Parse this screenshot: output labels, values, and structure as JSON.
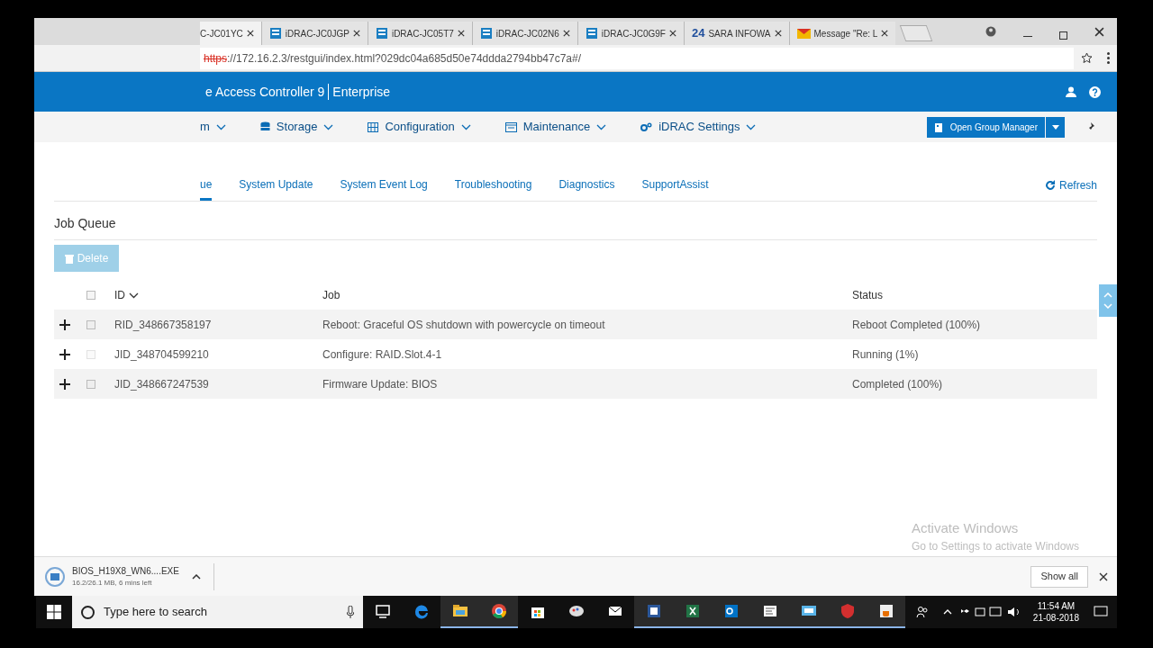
{
  "browser_tabs": [
    {
      "label": "C-JC01YC",
      "kind": "plain",
      "selected": true
    },
    {
      "label": "iDRAC-JC0JGP",
      "kind": "server",
      "selected": false
    },
    {
      "label": "iDRAC-JC05T7",
      "kind": "server",
      "selected": false
    },
    {
      "label": "iDRAC-JC02N6",
      "kind": "server",
      "selected": false
    },
    {
      "label": "iDRAC-JC0G9F",
      "kind": "server",
      "selected": false
    },
    {
      "label": "SARA INFOWA",
      "kind": "badge",
      "badge": "24",
      "selected": false
    },
    {
      "label": "Message \"Re: L",
      "kind": "mail",
      "selected": false
    }
  ],
  "address": {
    "scheme": "https",
    "rest": "://172.16.2.3/restgui/index.html?029dc04a685d50e74ddda2794bb47c7a#/"
  },
  "header": {
    "title": "e Access Controller 9",
    "edition": "Enterprise"
  },
  "nav": [
    {
      "label": "m",
      "kind": "plain"
    },
    {
      "label": "Storage",
      "kind": "storage"
    },
    {
      "label": "Configuration",
      "kind": "config"
    },
    {
      "label": "Maintenance",
      "kind": "maint"
    },
    {
      "label": "iDRAC Settings",
      "kind": "gear"
    }
  ],
  "group_manager_button": "Open Group Manager",
  "subtabs": [
    {
      "label": "ue",
      "selected": true
    },
    {
      "label": "System Update",
      "selected": false
    },
    {
      "label": "System Event Log",
      "selected": false
    },
    {
      "label": "Troubleshooting",
      "selected": false
    },
    {
      "label": "Diagnostics",
      "selected": false
    },
    {
      "label": "SupportAssist",
      "selected": false
    }
  ],
  "refresh": "Refresh",
  "section_title": "Job Queue",
  "delete_button": {
    "label": "Delete",
    "disabled": true
  },
  "table": {
    "columns": [
      "ID",
      "Job",
      "Status"
    ],
    "select_all_checked": false,
    "rows": [
      {
        "id": "RID_348667358197",
        "job": "Reboot: Graceful OS shutdown with powercycle on timeout",
        "status": "Reboot Completed (100%)",
        "checked": false,
        "disabled": false
      },
      {
        "id": "JID_348704599210",
        "job": "Configure: RAID.Slot.4-1",
        "status": "Running (1%)",
        "checked": false,
        "disabled": true
      },
      {
        "id": "JID_348667247539",
        "job": "Firmware Update: BIOS",
        "status": "Completed (100%)",
        "checked": false,
        "disabled": false
      }
    ]
  },
  "activation": {
    "title": "Activate Windows",
    "hint": "Go to Settings to activate Windows"
  },
  "download": {
    "file": "BIOS_H19X8_WN6....EXE",
    "progress": "16.2/26.1 MB, 6 mins left",
    "show_all": "Show all"
  },
  "taskbar": {
    "search_placeholder": "Type here to search",
    "time": "11:54 AM",
    "date": "21-08-2018",
    "apps": [
      {
        "kind": "taskview",
        "active": false
      },
      {
        "kind": "edge",
        "active": false
      },
      {
        "kind": "folder",
        "active": true
      },
      {
        "kind": "chrome",
        "active": true
      },
      {
        "kind": "store",
        "active": false
      },
      {
        "kind": "paint",
        "active": false
      },
      {
        "kind": "mail",
        "active": false
      },
      {
        "kind": "word",
        "active": true
      },
      {
        "kind": "excel",
        "active": true
      },
      {
        "kind": "outlook",
        "active": true
      },
      {
        "kind": "doc",
        "active": true
      },
      {
        "kind": "remote",
        "active": true
      },
      {
        "kind": "shield",
        "active": true
      },
      {
        "kind": "java",
        "active": true
      }
    ]
  }
}
